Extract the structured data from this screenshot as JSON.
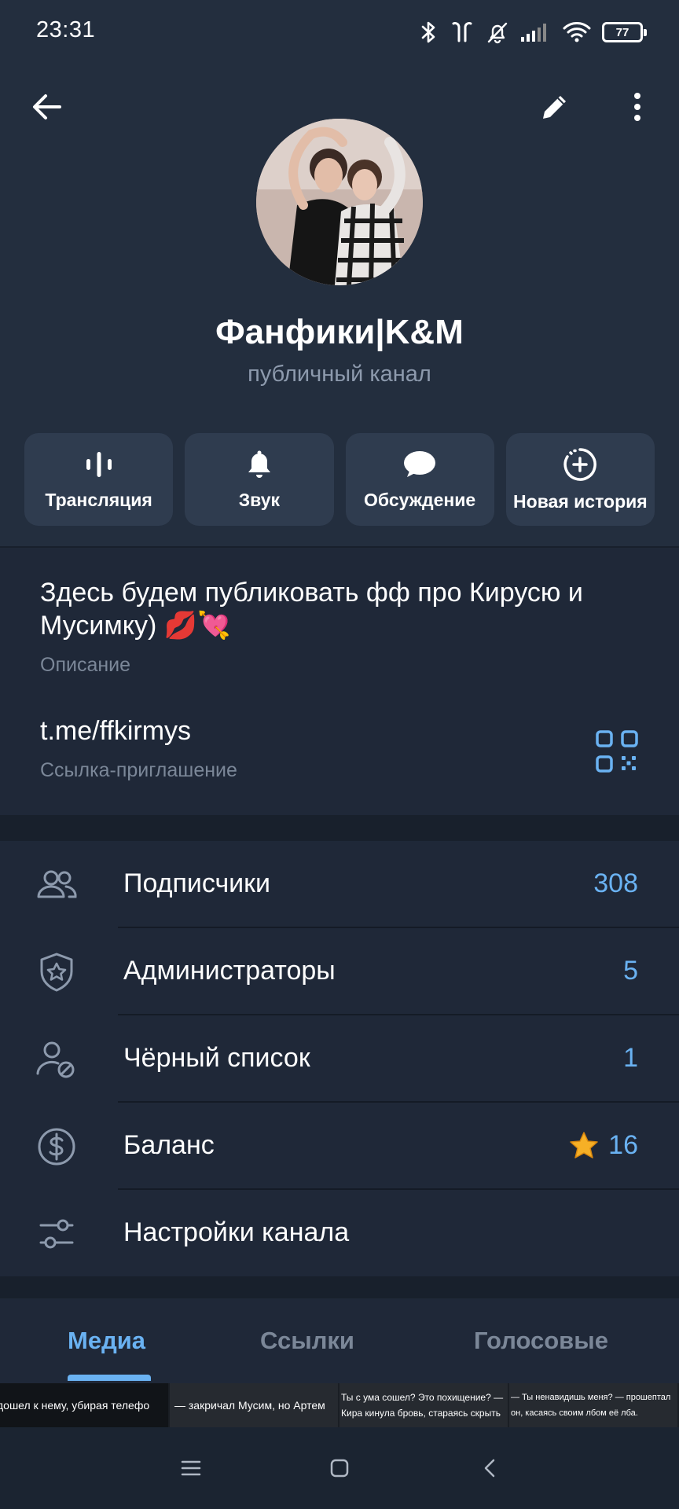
{
  "status_bar": {
    "time": "23:31",
    "battery": "77"
  },
  "header": {
    "title": "Фанфики|K&M",
    "subtitle": "публичный канал"
  },
  "actions": [
    {
      "label": "Трансляция",
      "icon": "broadcast-icon"
    },
    {
      "label": "Звук",
      "icon": "bell-icon"
    },
    {
      "label": "Обсуждение",
      "icon": "chat-bubble-icon"
    },
    {
      "label": "Новая история",
      "icon": "add-story-icon"
    }
  ],
  "info": {
    "description": "Здесь будем публиковать фф про Кирусю и Мусимку) 💋💘",
    "description_label": "Описание",
    "link": "t.me/ffkirmys",
    "link_label": "Ссылка-приглашение"
  },
  "menu": [
    {
      "label": "Подписчики",
      "value": "308",
      "icon": "subscribers-icon"
    },
    {
      "label": "Администраторы",
      "value": "5",
      "icon": "admin-shield-icon"
    },
    {
      "label": "Чёрный список",
      "value": "1",
      "icon": "blocked-user-icon"
    },
    {
      "label": "Баланс",
      "value": "16",
      "icon": "balance-dollar-icon"
    },
    {
      "label": "Настройки канала",
      "value": "",
      "icon": "settings-sliders-icon"
    }
  ],
  "tabs": [
    {
      "label": "Медиа",
      "active": true
    },
    {
      "label": "Ссылки",
      "active": false
    },
    {
      "label": "Голосовые",
      "active": false
    }
  ],
  "thumbnails": [
    "дошел к нему, убирая телефо",
    "— закричал Мусим, но Артем",
    "Ты с ума сошел? Это похищение? — Кира кинула бровь, стараясь скрыть",
    "— Ты ненавидишь меня? — прошептал он, касаясь своим лбом её лба."
  ],
  "colors": {
    "accent": "#6ab2f2",
    "header_bg": "#232e3e",
    "card_bg": "#1f2838",
    "page_bg": "#18202c",
    "button_bg": "#2f3c4f"
  }
}
